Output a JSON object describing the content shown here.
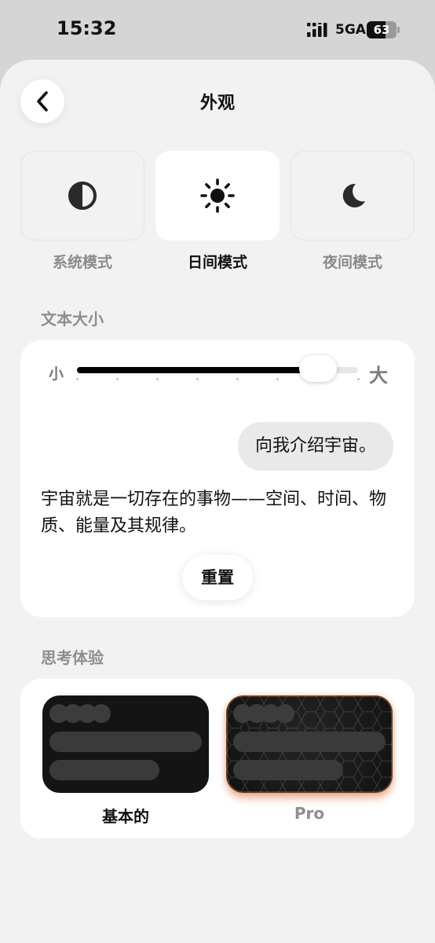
{
  "status_bar": {
    "time": "15:32",
    "network": "5GA",
    "battery_level": "63",
    "battery_fraction": 0.63
  },
  "header": {
    "title": "外观",
    "back_icon": "chevron-left-icon"
  },
  "theme": {
    "options": [
      {
        "label": "系统模式",
        "icon": "half-circle-icon",
        "selected": false
      },
      {
        "label": "日间模式",
        "icon": "sun-icon",
        "selected": true
      },
      {
        "label": "夜间模式",
        "icon": "moon-icon",
        "selected": false
      }
    ]
  },
  "text_size": {
    "section_label": "文本大小",
    "min_label": "小",
    "max_label": "大",
    "step_count": 8,
    "selected_step": 6,
    "user_message": "向我介绍宇宙。",
    "assistant_message": "宇宙就是一切存在的事物——空间、时间、物质、能量及其规律。",
    "reset_label": "重置"
  },
  "thinking": {
    "section_label": "思考体验",
    "options": [
      {
        "label": "基本的",
        "selected": true
      },
      {
        "label": "Pro",
        "selected": false
      }
    ],
    "glow_color": "#d2642a"
  },
  "colors": {
    "background": "#f2f2f2",
    "card": "#ffffff",
    "text_primary": "#111111",
    "text_secondary": "#8e8e8e"
  }
}
